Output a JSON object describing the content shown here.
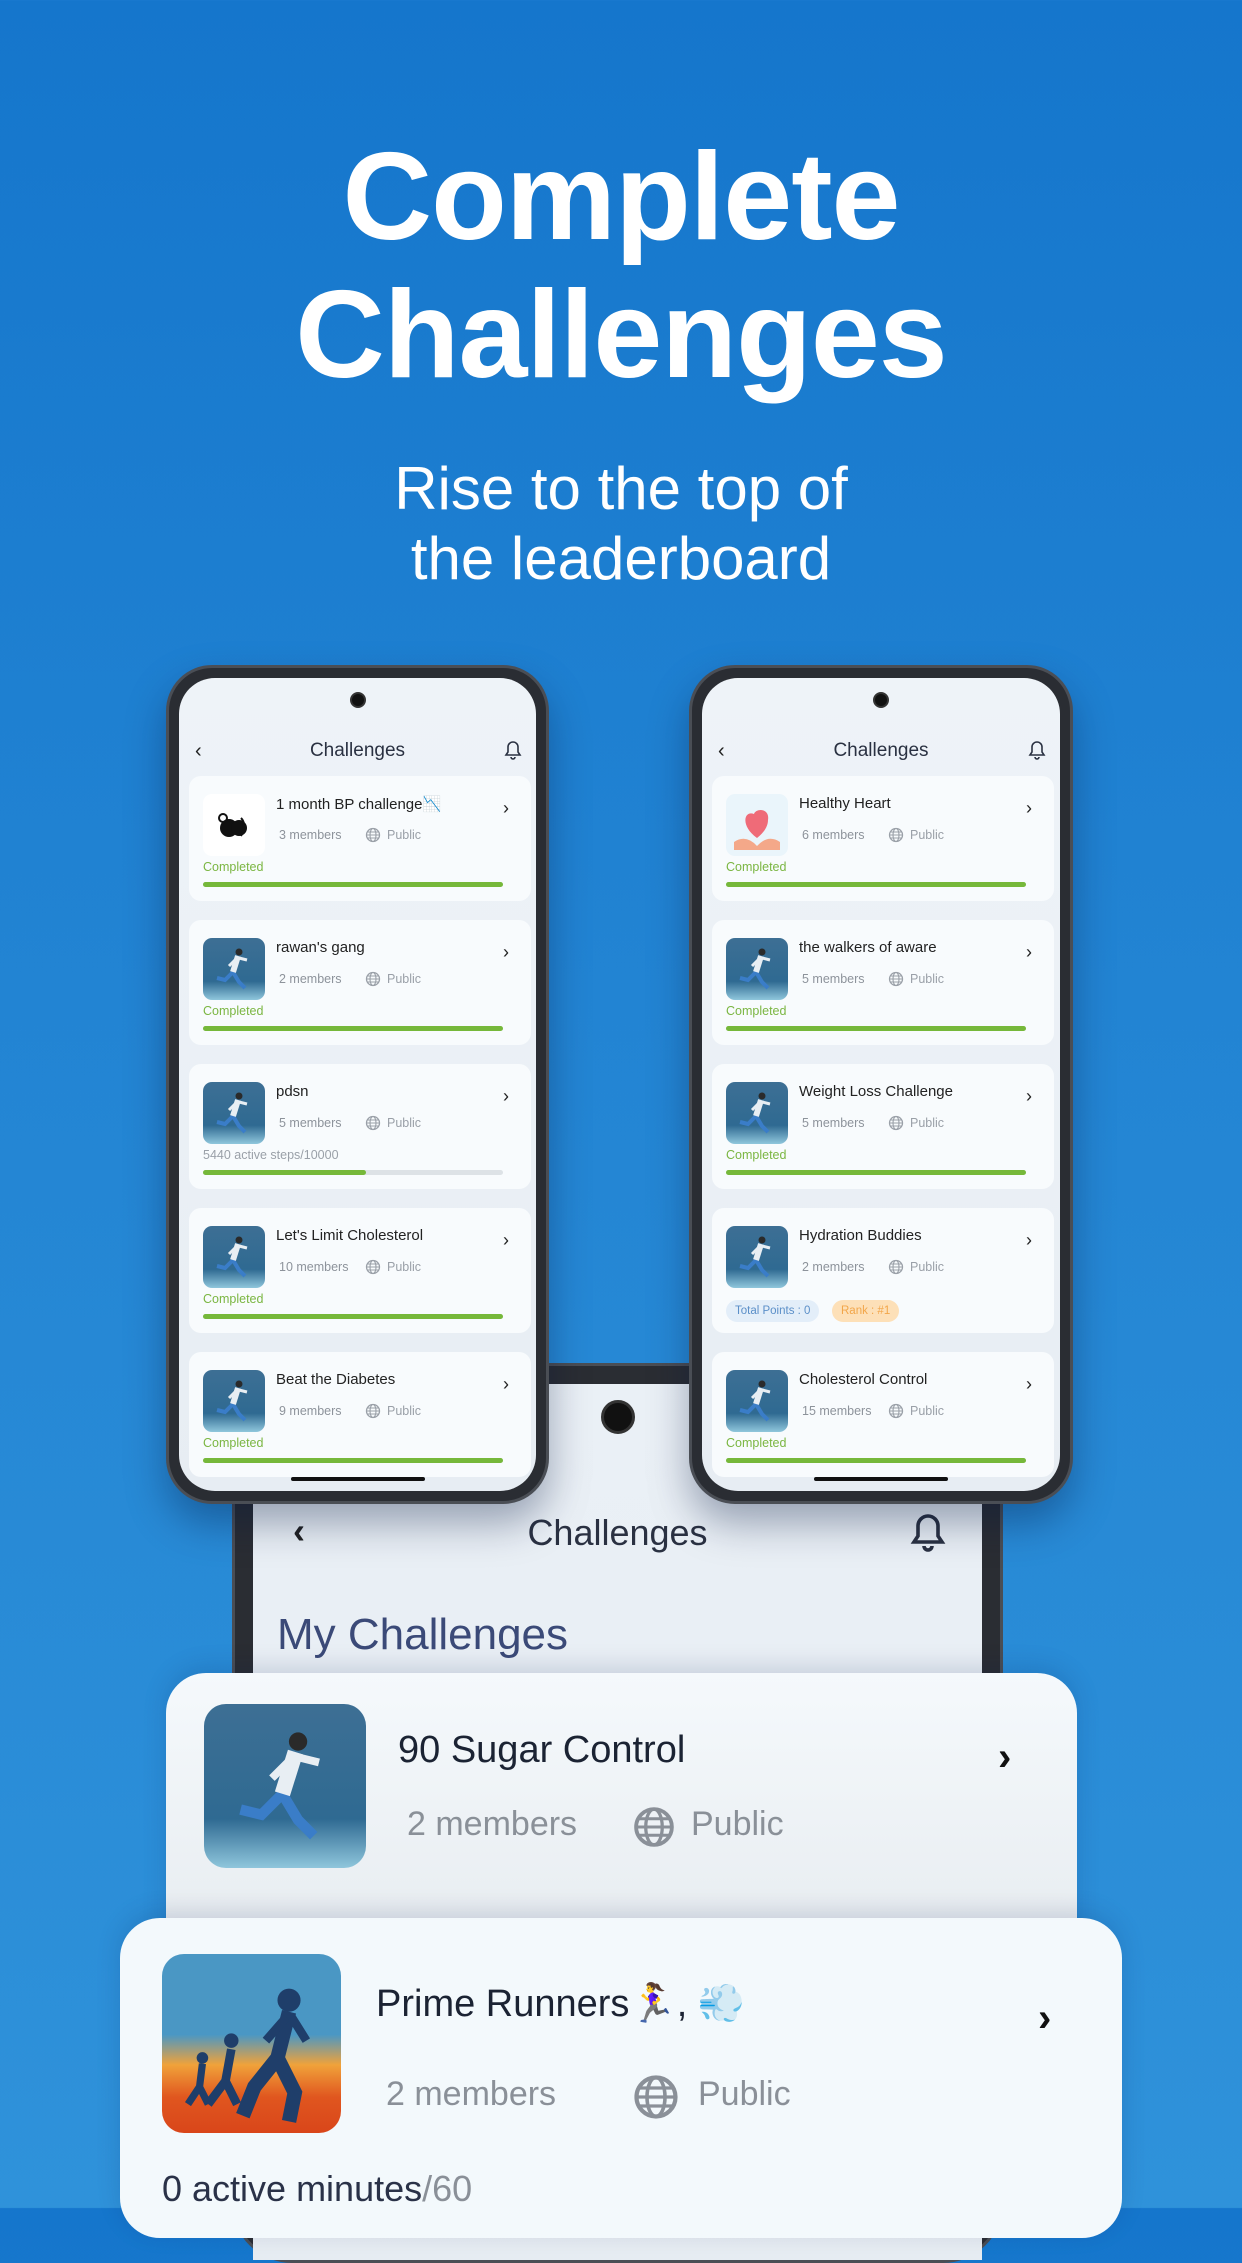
{
  "hero": {
    "title_line1": "Complete",
    "title_line2": "Challenges",
    "subtitle_line1": "Rise to the top of",
    "subtitle_line2": "the leaderboard"
  },
  "colors": {
    "background": "#1a7dd0",
    "completed": "#7bb642",
    "progress": "#76b83a",
    "points_pill": "#e3eef9",
    "rank_pill": "#fde0b8"
  },
  "screen_header": {
    "title": "Challenges",
    "back_icon": "chevron-left-icon",
    "notification_icon": "bell-icon"
  },
  "left_phone": {
    "cards": [
      {
        "title": "1 month BP challenge📉",
        "members": "3 members",
        "visibility": "Public",
        "status": "Completed",
        "progress": 1.0,
        "thumb": "bp"
      },
      {
        "title": "rawan's gang",
        "members": "2 members",
        "visibility": "Public",
        "status": "Completed",
        "progress": 1.0,
        "thumb": "runner"
      },
      {
        "title": "pdsn",
        "members": "5 members",
        "visibility": "Public",
        "status_value": "5440 active steps",
        "status_goal": "/10000",
        "progress": 0.544,
        "thumb": "runner"
      },
      {
        "title": "Let's Limit Cholesterol",
        "members": "10 members",
        "visibility": "Public",
        "status": "Completed",
        "progress": 1.0,
        "thumb": "runner"
      },
      {
        "title": "Beat the Diabetes",
        "members": "9 members",
        "visibility": "Public",
        "status": "Completed",
        "progress": 1.0,
        "thumb": "runner"
      }
    ]
  },
  "right_phone": {
    "cards": [
      {
        "title": "Healthy Heart",
        "members": "6 members",
        "visibility": "Public",
        "status": "Completed",
        "progress": 1.0,
        "thumb": "heart"
      },
      {
        "title": "the walkers of aware",
        "members": "5 members",
        "visibility": "Public",
        "status": "Completed",
        "progress": 1.0,
        "thumb": "runner"
      },
      {
        "title": "Weight Loss Challenge",
        "members": "5 members",
        "visibility": "Public",
        "status": "Completed",
        "progress": 1.0,
        "thumb": "runner"
      },
      {
        "title": "Hydration Buddies",
        "members": "2 members",
        "visibility": "Public",
        "points": "Total Points : 0",
        "rank": "Rank : #1",
        "thumb": "runner"
      },
      {
        "title": "Cholesterol Control",
        "members": "15 members",
        "visibility": "Public",
        "status": "Completed",
        "progress": 1.0,
        "thumb": "runner"
      }
    ]
  },
  "big_phone": {
    "title": "Challenges",
    "section": "My Challenges"
  },
  "featured": [
    {
      "title": "90 Sugar Control",
      "members": "2 members",
      "visibility": "Public"
    },
    {
      "title": "Prime Runners🏃‍♀️, 💨",
      "members": "2 members",
      "visibility": "Public",
      "status_value": "0 active minutes",
      "status_goal": "/60"
    }
  ]
}
